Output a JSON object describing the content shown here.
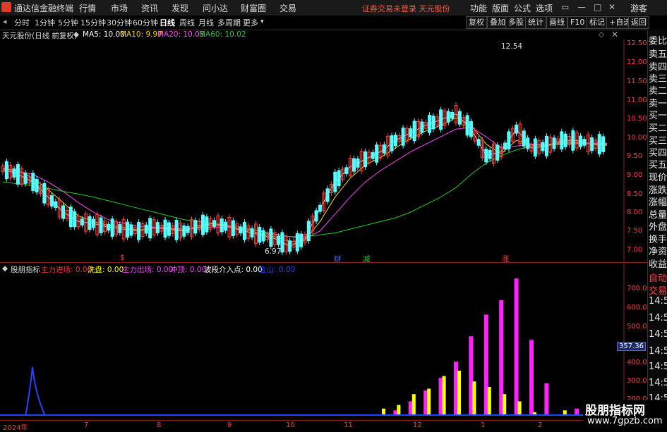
{
  "app": {
    "title": "通达信金融终端"
  },
  "menu": [
    "行情",
    "市场",
    "资讯",
    "发现",
    "问小达",
    "财富圈",
    "交易"
  ],
  "login_status": "证券交易未登录  天元股份",
  "top_right": [
    "功能",
    "版面",
    "公式",
    "选项",
    "游客"
  ],
  "periods": [
    "分时",
    "1分钟",
    "5分钟",
    "15分钟",
    "30分钟",
    "60分钟",
    "日线",
    "周线",
    "月线",
    "多周期",
    "更多"
  ],
  "active_period": "日线",
  "right_tools": [
    "复权",
    "叠加",
    "多股",
    "统计",
    "画线",
    "F10",
    "标记",
    "+自选",
    "返回"
  ],
  "main_chart": {
    "stock_label": "天元股份(日线 前复权)",
    "ma": [
      {
        "label": "MA5: 10.00",
        "color": "#ffffff"
      },
      {
        "label": "MA10: 9.97",
        "color": "#ffd700"
      },
      {
        "label": "MA20: 10.03",
        "color": "#ff44ff"
      },
      {
        "label": "MA60: 10.02",
        "color": "#22cc22"
      }
    ],
    "high_label": "12.54",
    "low_label": "6.97",
    "y_ticks": [
      "12.50",
      "12.00",
      "11.50",
      "11.00",
      "10.50",
      "10.00",
      "9.50",
      "9.00",
      "8.50",
      "8.00",
      "7.50",
      "7.00"
    ],
    "markers": [
      {
        "text": "$",
        "color": "#ff3030"
      },
      {
        "text": "财",
        "color": "#4a6cff"
      },
      {
        "text": "减",
        "color": "#22cc22"
      },
      {
        "text": "涨",
        "color": "#ff3030"
      }
    ]
  },
  "indicator": {
    "name": "股朋指标",
    "items": [
      {
        "label": "主力进场: 0.00",
        "color": "#ff3030"
      },
      {
        "label": "洗盘: 0.00",
        "color": "#ffff00"
      },
      {
        "label": "主力出场: 0.00",
        "color": "#ff44ff"
      },
      {
        "label": "冲顶: 0.00",
        "color": "#ff44ff"
      },
      {
        "label": "波段介入点: 0.00",
        "color": "#ffffff"
      },
      {
        "label": "金山: 0.00",
        "color": "#2244ff"
      }
    ],
    "y_ticks": [
      "700.0",
      "600.0",
      "500.0",
      "400.0",
      "300.0",
      "200.0"
    ],
    "cursor_value": "357.36"
  },
  "x_ticks": [
    "2024年",
    "7",
    "8",
    "9",
    "10",
    "11",
    "12",
    "1",
    "2"
  ],
  "right_panel": [
    "委比",
    "卖五",
    "卖四",
    "卖三",
    "卖二",
    "卖一",
    "买一",
    "买二",
    "买三",
    "买四",
    "买五",
    "现价",
    "涨跌",
    "涨幅",
    "总量",
    "外盘",
    "换手",
    "净资",
    "收益",
    "自动",
    "交易",
    "14:56",
    "14:56",
    "14:56",
    "14:56",
    "14:56",
    "14:56",
    "14:56",
    "14:56"
  ],
  "watermark": {
    "line1": "股朋指标网",
    "line2": "www.7gpzb.com"
  },
  "chart_data": {
    "type": "line",
    "ylim": [
      6.8,
      12.7
    ],
    "ma_series": [
      {
        "name": "MA5",
        "values": [
          9.35,
          9.2,
          9.0,
          8.6,
          8.2,
          7.95,
          7.9,
          7.8,
          7.75,
          7.7,
          7.8,
          7.75,
          7.7,
          7.85,
          7.9,
          7.8,
          7.7,
          7.6,
          7.5,
          7.3,
          7.5,
          8.3,
          9.0,
          9.4,
          9.6,
          9.8,
          10.1,
          10.3,
          10.5,
          10.65,
          10.8,
          10.4,
          9.7,
          9.8,
          10.4,
          9.9,
          9.95,
          10.1,
          10.1,
          10.0,
          10.0
        ]
      },
      {
        "name": "MA10",
        "values": [
          9.35,
          9.3,
          9.1,
          8.8,
          8.45,
          8.1,
          7.95,
          7.85,
          7.8,
          7.72,
          7.78,
          7.76,
          7.72,
          7.8,
          7.86,
          7.82,
          7.74,
          7.64,
          7.55,
          7.42,
          7.45,
          7.95,
          8.6,
          9.1,
          9.45,
          9.65,
          9.9,
          10.15,
          10.35,
          10.5,
          10.7,
          10.5,
          10.0,
          9.75,
          10.1,
          10.0,
          9.95,
          10.05,
          10.05,
          10.0,
          9.97
        ]
      },
      {
        "name": "MA20",
        "values": [
          9.3,
          9.28,
          9.2,
          9.0,
          8.75,
          8.45,
          8.2,
          8.0,
          7.9,
          7.82,
          7.8,
          7.78,
          7.75,
          7.78,
          7.8,
          7.8,
          7.76,
          7.7,
          7.62,
          7.55,
          7.5,
          7.7,
          8.15,
          8.6,
          9.0,
          9.3,
          9.55,
          9.8,
          10.0,
          10.2,
          10.4,
          10.45,
          10.2,
          9.9,
          9.95,
          10.0,
          10.0,
          10.02,
          10.03,
          10.03,
          10.03
        ]
      },
      {
        "name": "MA60",
        "values": [
          9.0,
          8.95,
          8.9,
          8.83,
          8.75,
          8.68,
          8.6,
          8.5,
          8.4,
          8.3,
          8.2,
          8.1,
          8.0,
          7.95,
          7.9,
          7.85,
          7.8,
          7.7,
          7.6,
          7.55,
          7.55,
          7.6,
          7.65,
          7.75,
          7.85,
          7.95,
          8.05,
          8.2,
          8.4,
          8.6,
          8.85,
          9.2,
          9.5,
          9.7,
          9.85,
          9.95,
          10.0,
          10.0,
          10.01,
          10.02,
          10.02
        ]
      }
    ],
    "indicator_ylim": [
      0,
      780
    ],
    "magenta_bars": [
      0,
      0,
      0,
      0,
      0,
      0,
      0,
      0,
      0,
      0,
      0,
      0,
      0,
      0,
      0,
      0,
      0,
      0,
      0,
      0,
      0,
      0,
      0,
      0,
      0,
      0,
      30,
      80,
      140,
      210,
      300,
      440,
      560,
      640,
      760,
      420,
      180,
      0,
      40,
      0,
      0
    ],
    "yellow_bars": [
      0,
      0,
      0,
      0,
      0,
      0,
      0,
      0,
      0,
      0,
      0,
      0,
      0,
      0,
      0,
      0,
      0,
      0,
      0,
      0,
      0,
      0,
      0,
      0,
      0,
      40,
      60,
      120,
      150,
      220,
      250,
      190,
      160,
      120,
      80,
      20,
      0,
      30,
      0,
      0,
      0
    ]
  }
}
